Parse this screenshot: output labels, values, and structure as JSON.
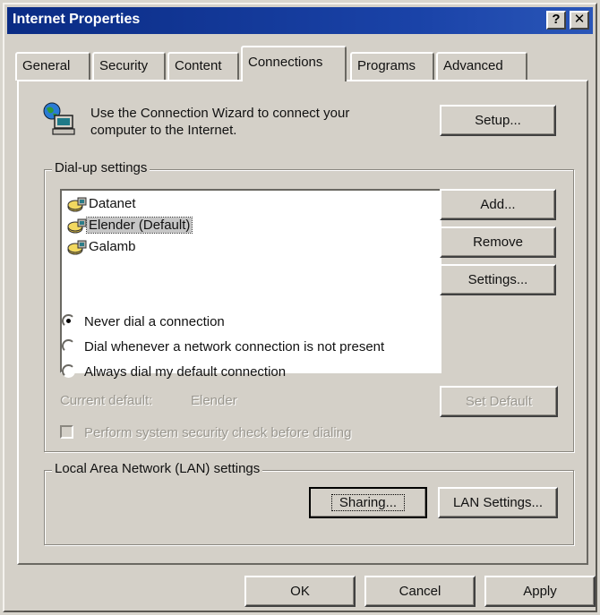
{
  "window": {
    "title": "Internet Properties"
  },
  "title_buttons": {
    "help": "?",
    "close": "✕"
  },
  "tabs": [
    {
      "label": "General"
    },
    {
      "label": "Security"
    },
    {
      "label": "Content"
    },
    {
      "label": "Connections",
      "active": true
    },
    {
      "label": "Programs"
    },
    {
      "label": "Advanced"
    }
  ],
  "wizard": {
    "text_line1": "Use the Connection Wizard to connect your",
    "text_line2": "computer to the Internet.",
    "setup_label": "Setup..."
  },
  "dialup": {
    "legend": "Dial-up settings",
    "connections": [
      {
        "label": "Datanet"
      },
      {
        "label": "Elender (Default)",
        "selected": true
      },
      {
        "label": "Galamb"
      }
    ],
    "add_label": "Add...",
    "remove_label": "Remove",
    "settings_label": "Settings...",
    "options": [
      {
        "label": "Never dial a connection",
        "checked": true
      },
      {
        "label": "Dial whenever a network connection is not present",
        "checked": false
      },
      {
        "label": "Always dial my default connection",
        "checked": false
      }
    ],
    "current_default_label": "Current default:",
    "current_default_value": "Elender",
    "set_default_label": "Set Default",
    "security_check_label": "Perform system security check before dialing"
  },
  "lan": {
    "legend": "Local Area Network (LAN) settings",
    "sharing_label": "Sharing...",
    "lan_settings_label": "LAN Settings..."
  },
  "footer": {
    "ok_label": "OK",
    "cancel_label": "Cancel",
    "apply_label": "Apply"
  },
  "colors": {
    "title_bar": "#0a2b84",
    "face": "#d4d0c8"
  },
  "icons": {
    "wizard": "globe-computer-icon",
    "connection": "dialup-connection-icon"
  }
}
